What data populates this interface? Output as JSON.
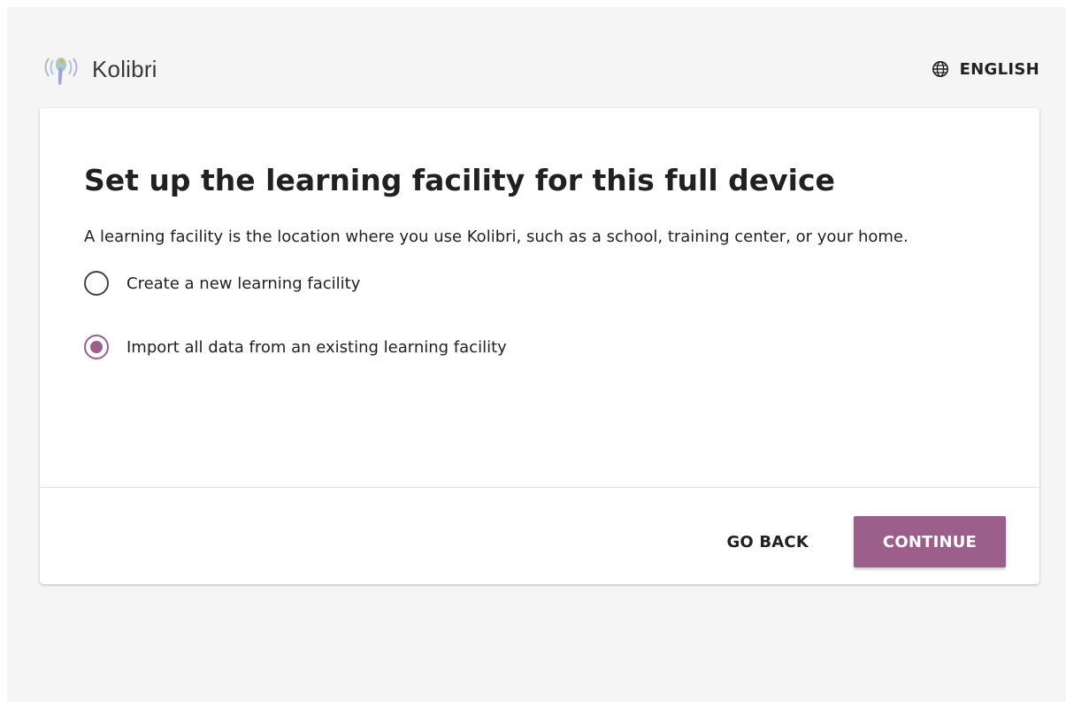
{
  "header": {
    "app_name": "Kolibri",
    "language_label": "ENGLISH"
  },
  "icons": {
    "logo": "kolibri-logo-icon",
    "language": "globe-icon"
  },
  "colors": {
    "accent": "#9c5f8c",
    "background": "#f5f5f5",
    "card": "#ffffff",
    "text": "#212121"
  },
  "card": {
    "title": "Set up the learning facility for this full device",
    "description": "A learning facility is the location where you use Kolibri, such as a school, training center, or your home.",
    "options": [
      {
        "label": "Create a new learning facility",
        "selected": false
      },
      {
        "label": "Import all data from an existing learning facility",
        "selected": true
      }
    ],
    "footer": {
      "back_label": "GO BACK",
      "continue_label": "CONTINUE"
    }
  }
}
